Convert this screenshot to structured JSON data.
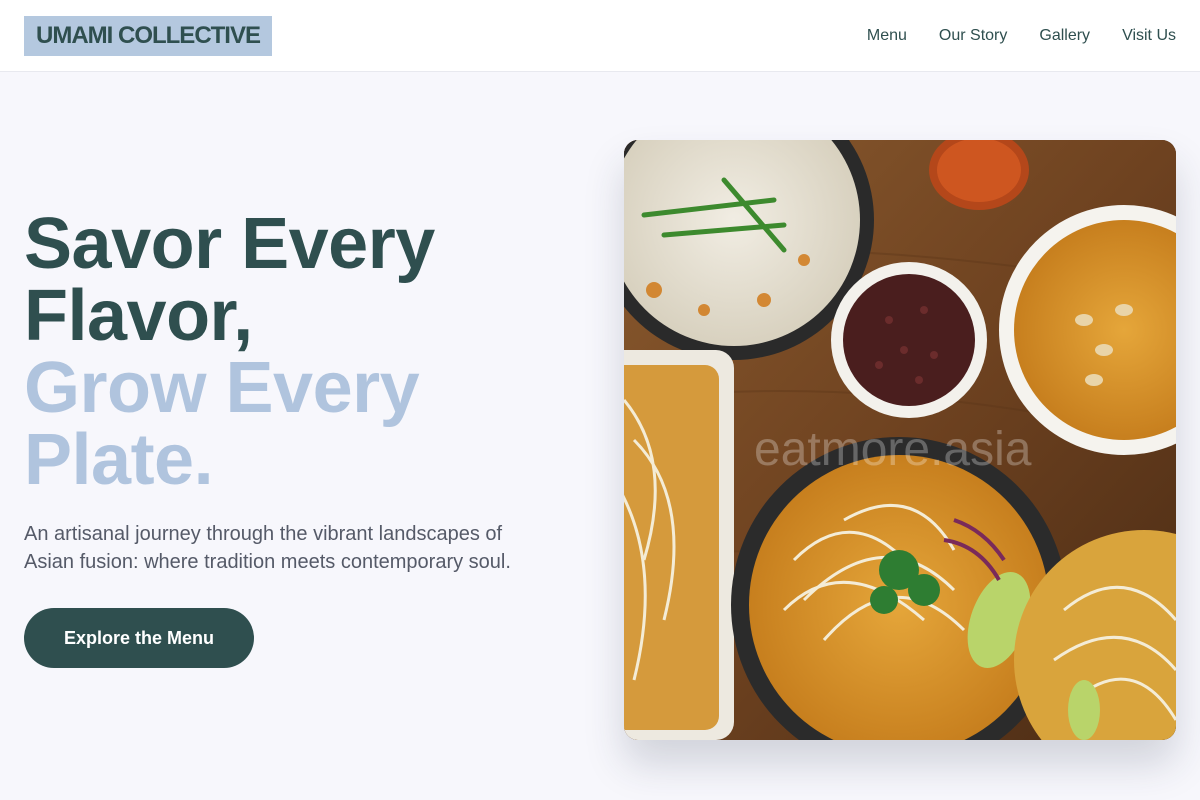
{
  "brand": {
    "name": "UMAMI COLLECTIVE"
  },
  "nav": {
    "items": [
      "Menu",
      "Our Story",
      "Gallery",
      "Visit Us"
    ]
  },
  "hero": {
    "headline_line1": "Savor Every Flavor,",
    "headline_line2": "Grow Every Plate.",
    "subtitle": "An artisanal journey through the vibrant landscapes of Asian fusion: where tradition meets contemporary soul.",
    "cta_label": "Explore the Menu",
    "image_watermark": "eatmore.asia"
  },
  "colors": {
    "primary": "#2f4f4f",
    "accent": "#b0c4de",
    "background": "#f7f7fc"
  }
}
